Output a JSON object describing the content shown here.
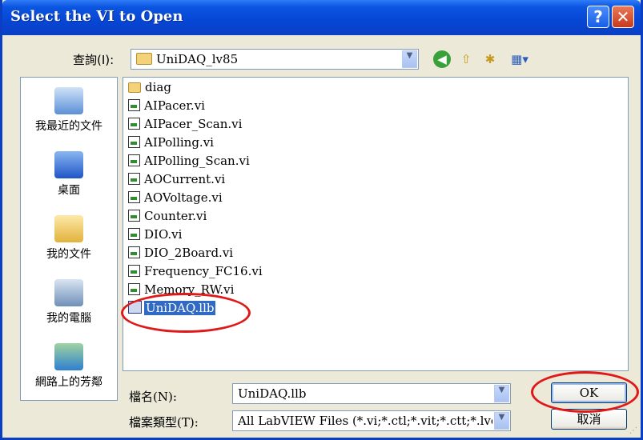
{
  "window": {
    "title": "Select the VI to Open"
  },
  "toolbar": {
    "look_in_label": "查詢(I):",
    "look_in_value": "UniDAQ_lv85"
  },
  "places": [
    {
      "label": "我最近的文件",
      "icon": "recent-documents-icon"
    },
    {
      "label": "桌面",
      "icon": "desktop-icon"
    },
    {
      "label": "我的文件",
      "icon": "my-documents-icon"
    },
    {
      "label": "我的電腦",
      "icon": "my-computer-icon"
    },
    {
      "label": "網路上的芳鄰",
      "icon": "network-icon"
    }
  ],
  "files": [
    {
      "name": "diag",
      "type": "folder"
    },
    {
      "name": "AIPacer.vi",
      "type": "vi"
    },
    {
      "name": "AIPacer_Scan.vi",
      "type": "vi"
    },
    {
      "name": "AIPolling.vi",
      "type": "vi"
    },
    {
      "name": "AIPolling_Scan.vi",
      "type": "vi"
    },
    {
      "name": "AOCurrent.vi",
      "type": "vi"
    },
    {
      "name": "AOVoltage.vi",
      "type": "vi"
    },
    {
      "name": "Counter.vi",
      "type": "vi"
    },
    {
      "name": "DIO.vi",
      "type": "vi"
    },
    {
      "name": "DIO_2Board.vi",
      "type": "vi"
    },
    {
      "name": "Frequency_FC16.vi",
      "type": "vi"
    },
    {
      "name": "Memory_RW.vi",
      "type": "vi"
    },
    {
      "name": "UniDAQ.llb",
      "type": "llb",
      "selected": true
    }
  ],
  "form": {
    "filename_label": "檔名(N):",
    "filename_value": "UniDAQ.llb",
    "filetype_label": "檔案類型(T):",
    "filetype_value": "All LabVIEW Files (*.vi;*.ctl;*.vit;*.ctt;*.lvclas"
  },
  "buttons": {
    "ok": "OK",
    "cancel": "取消"
  },
  "colors": {
    "selection": "#316ac5",
    "annotation": "#e01818",
    "titlebar": "#0a3fc4"
  }
}
